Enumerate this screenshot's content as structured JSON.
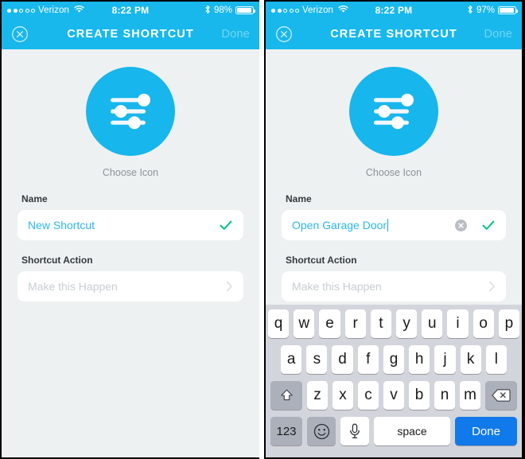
{
  "theme": {
    "accent": "#18b8ed",
    "icon_circle": "#17b6ec",
    "page_bg": "#eef1f2",
    "field_bg": "#ffffff",
    "value_text": "#2cb6e8",
    "placeholder_text": "#c7ced2",
    "check_green": "#00c389",
    "done_key_blue": "#117aeb",
    "keyboard_bg": "#d2d5db",
    "key_fn_bg": "#abb0bb",
    "nav_done_disabled": "#72d7f4"
  },
  "panels": [
    {
      "id": "left",
      "status_bar": {
        "carrier": "Verizon",
        "signal_filled": 2,
        "signal_total": 5,
        "wifi_icon": "wifi-icon",
        "time": "8:22 PM",
        "bluetooth_icon": "bluetooth-icon",
        "battery_percent": "98%",
        "battery_icon": "battery-icon"
      },
      "nav_bar": {
        "close_icon": "close-circle-icon",
        "title": "CREATE SHORTCUT",
        "done_label": "Done"
      },
      "icon_picker": {
        "icon_name": "sliders-icon",
        "label": "Choose Icon"
      },
      "fields": [
        {
          "label": "Name",
          "value": "New Shortcut",
          "placeholder": "New Shortcut",
          "has_clear": false,
          "has_check": true,
          "has_chevron": false,
          "has_caret": false
        },
        {
          "label": "Shortcut Action",
          "value": "",
          "placeholder": "Make this Happen",
          "has_clear": false,
          "has_check": false,
          "has_chevron": true,
          "has_caret": false
        }
      ],
      "keyboard_visible": false
    },
    {
      "id": "right",
      "status_bar": {
        "carrier": "Verizon",
        "signal_filled": 2,
        "signal_total": 5,
        "wifi_icon": "wifi-icon",
        "time": "8:22 PM",
        "bluetooth_icon": "bluetooth-icon",
        "battery_percent": "97%",
        "battery_icon": "battery-icon"
      },
      "nav_bar": {
        "close_icon": "close-circle-icon",
        "title": "CREATE SHORTCUT",
        "done_label": "Done"
      },
      "icon_picker": {
        "icon_name": "sliders-icon",
        "label": "Choose Icon"
      },
      "fields": [
        {
          "label": "Name",
          "value": "Open Garage Door",
          "placeholder": "New Shortcut",
          "has_clear": true,
          "has_check": true,
          "has_chevron": false,
          "has_caret": true
        },
        {
          "label": "Shortcut Action",
          "value": "",
          "placeholder": "Make this Happen",
          "has_clear": false,
          "has_check": false,
          "has_chevron": true,
          "has_caret": false
        }
      ],
      "keyboard_visible": true
    }
  ],
  "keyboard": {
    "row1": [
      "q",
      "w",
      "e",
      "r",
      "t",
      "y",
      "u",
      "i",
      "o",
      "p"
    ],
    "row2": [
      "a",
      "s",
      "d",
      "f",
      "g",
      "h",
      "j",
      "k",
      "l"
    ],
    "row3": [
      "z",
      "x",
      "c",
      "v",
      "b",
      "n",
      "m"
    ],
    "shift_icon": "shift-icon",
    "delete_icon": "backspace-icon",
    "numbers_label": "123",
    "emoji_icon": "emoji-icon",
    "mic_icon": "microphone-icon",
    "space_label": "space",
    "done_label": "Done"
  }
}
